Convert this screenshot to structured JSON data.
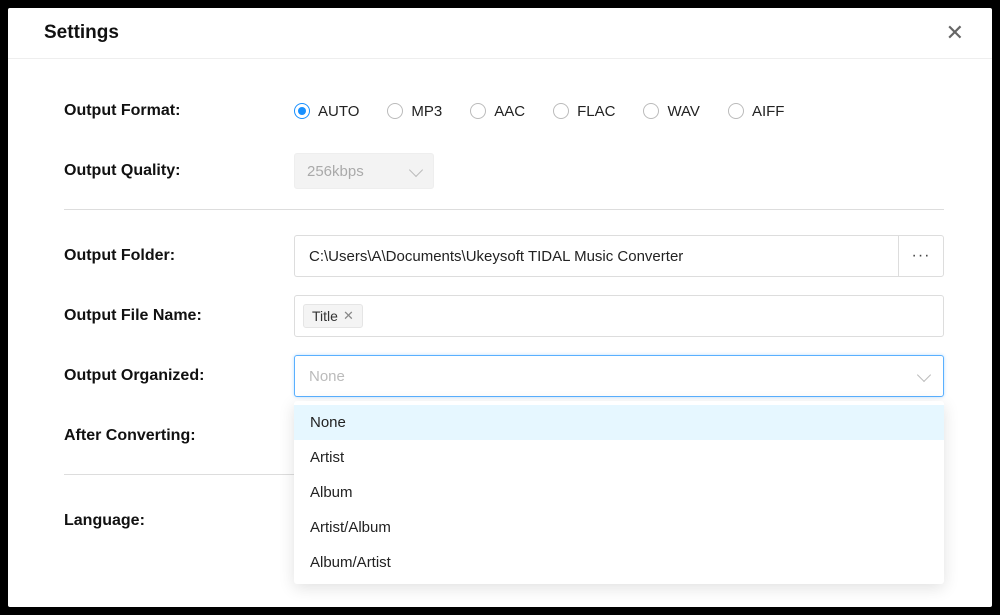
{
  "title": "Settings",
  "labels": {
    "outputFormat": "Output Format:",
    "outputQuality": "Output Quality:",
    "outputFolder": "Output Folder:",
    "outputFileName": "Output File Name:",
    "outputOrganized": "Output Organized:",
    "afterConverting": "After Converting:",
    "language": "Language:"
  },
  "formats": {
    "selected": "AUTO",
    "options": [
      "AUTO",
      "MP3",
      "AAC",
      "FLAC",
      "WAV",
      "AIFF"
    ]
  },
  "quality": {
    "value": "256kbps"
  },
  "folder": {
    "value": "C:\\Users\\A\\Documents\\Ukeysoft TIDAL Music Converter",
    "browse": "···"
  },
  "filename": {
    "tags": [
      {
        "label": "Title"
      }
    ]
  },
  "organized": {
    "placeholder": "None",
    "options": [
      "None",
      "Artist",
      "Album",
      "Artist/Album",
      "Album/Artist"
    ],
    "highlightedIndex": 0
  }
}
